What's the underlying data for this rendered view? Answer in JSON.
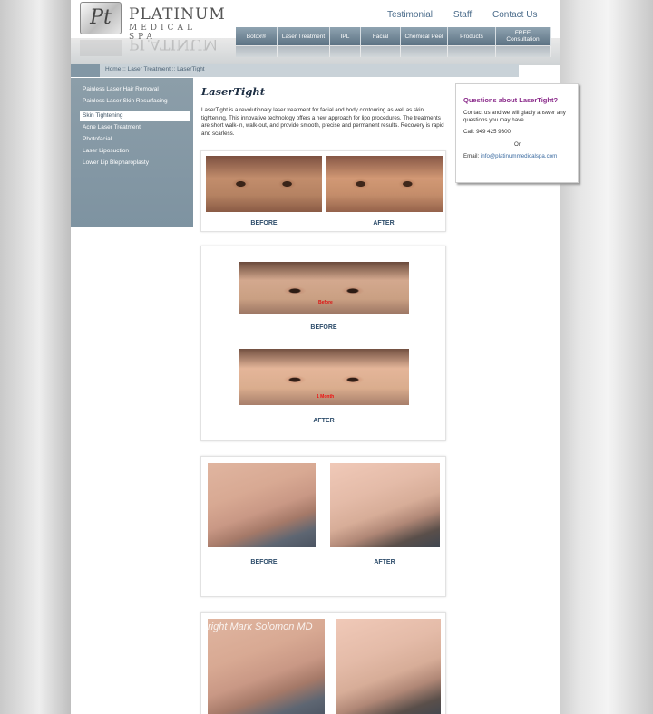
{
  "brand": {
    "logo_mark": "Pt",
    "name_line1": "PLATINUM",
    "name_line2": "MEDICAL SPA"
  },
  "top_links": [
    {
      "label": "Testimonial"
    },
    {
      "label": "Staff"
    },
    {
      "label": "Contact Us"
    }
  ],
  "nav": [
    {
      "label": "Botox®",
      "width": 46
    },
    {
      "label": "Laser Treatment",
      "width": 58
    },
    {
      "label": "IPL",
      "width": 34
    },
    {
      "label": "Facial",
      "width": 44
    },
    {
      "label": "Chemical Peel",
      "width": 52
    },
    {
      "label": "Products",
      "width": 53
    },
    {
      "label": "FREE Consultation",
      "width": 60
    }
  ],
  "breadcrumb": {
    "home": "Home",
    "sep1": " :: ",
    "section": "Laser Treatment",
    "sep2": " :: ",
    "current": "LaserTight"
  },
  "sidebar": {
    "items": [
      {
        "label": "Painless Laser Hair Removal",
        "active": false
      },
      {
        "label": "Painless Laser Skin Resurfacing",
        "active": false
      },
      {
        "label": "Skin Tightening",
        "active": true
      },
      {
        "label": "Acne Laser Treatment",
        "active": false
      },
      {
        "label": "Photofacial",
        "active": false
      },
      {
        "label": "Laser Liposuction",
        "active": false
      },
      {
        "label": "Lower Lip Blepharoplasty",
        "active": false
      }
    ]
  },
  "content": {
    "title": "LaserTight",
    "intro": "LaserTight is a revolutionary laser treatment for facial and body contouring as well as skin tightening. This innovative technology offers a new approach for lipo procedures. The treatments are short walk-in, walk-out, and provide smooth, precise and permanent results. Recovery is rapid and scarless."
  },
  "gallery": {
    "before": "BEFORE",
    "after": "AFTER",
    "photo2_before_tag": "Before",
    "photo2_after_tag": "1 Month",
    "watermark": "right Mark Solomon MD"
  },
  "question_box": {
    "title": "Questions about LaserTight?",
    "text": "Contact us and we will gladly answer any questions you may have.",
    "phone": "Call: 949 425 9300",
    "or": "Or",
    "email_label": "Email: ",
    "email": "info@platinummedicalspa.com"
  }
}
